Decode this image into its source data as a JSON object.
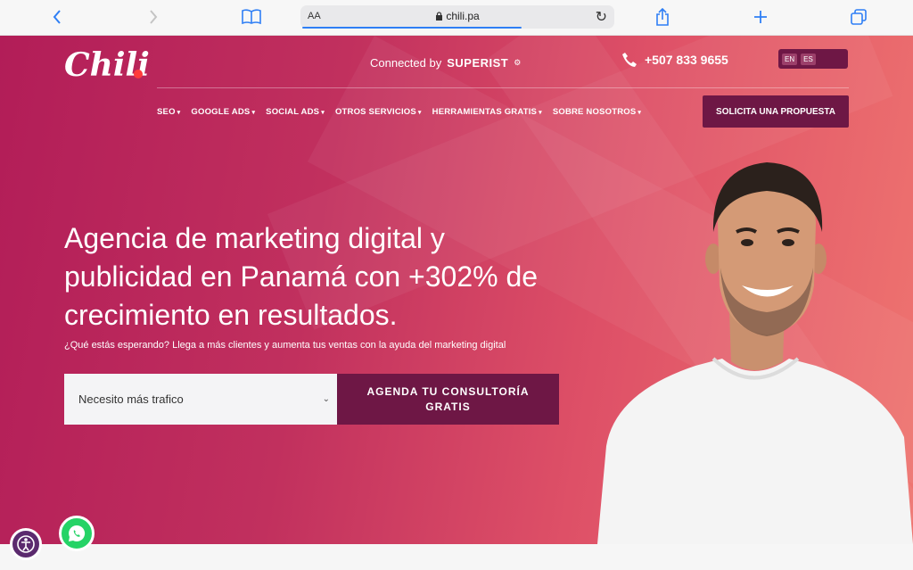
{
  "browser": {
    "address_font_label": "AA",
    "url": "chili.pa"
  },
  "site": {
    "logo_text": "Chili",
    "connected_prefix": "Connected by",
    "connected_brand": "SUPERIST",
    "phone": "+507 833 9655",
    "languages": [
      "EN",
      "ES"
    ],
    "nav": [
      "SEO",
      "GOOGLE ADS",
      "SOCIAL ADS",
      "OTROS SERVICIOS",
      "HERRAMIENTAS GRATIS",
      "SOBRE NOSOTROS"
    ],
    "cta_top": "SOLICITA UNA PROPUESTA",
    "headline": "Agencia de marketing digital y publicidad en Panamá con +302% de crecimiento en resultados.",
    "subheadline": "¿Qué estás esperando? Llega a más clientes y aumenta tus ventas con la ayuda del marketing digital",
    "form_select_value": "Necesito más trafico",
    "form_submit": "AGENDA TU CONSULTORÍA GRATIS"
  },
  "colors": {
    "brand_dark": "#6e1745",
    "hero_start": "#b21d58",
    "hero_end": "#ef7570",
    "whatsapp": "#25d366",
    "safari_blue": "#2f7ff5"
  },
  "icons": [
    "back-icon",
    "forward-icon",
    "bookmarks-icon",
    "lock-icon",
    "reload-icon",
    "share-icon",
    "new-tab-icon",
    "tabs-icon",
    "phone-icon",
    "whatsapp-icon",
    "accessibility-icon"
  ]
}
